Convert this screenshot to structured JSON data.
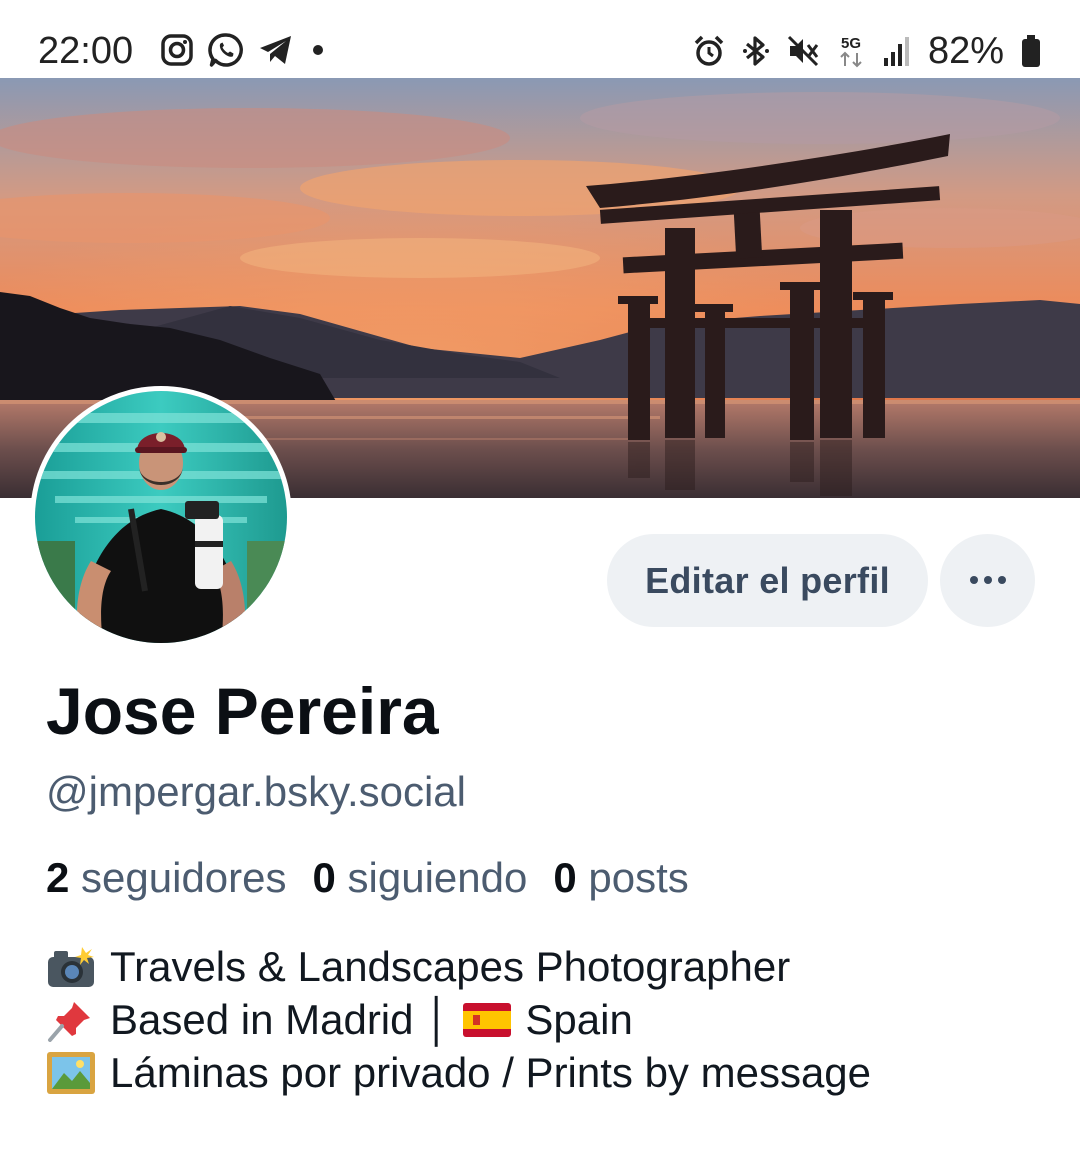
{
  "status_bar": {
    "time": "22:00",
    "battery": "82%",
    "left_icons": [
      "instagram-icon",
      "whatsapp-icon",
      "telegram-icon",
      "notification-dot-icon"
    ],
    "right_icons": [
      "alarm-icon",
      "bluetooth-icon",
      "mute-icon",
      "5g-icon",
      "signal-icon",
      "battery-icon"
    ],
    "network_label": "5G"
  },
  "banner": {
    "description_icon": "torii-gate-sunset-image"
  },
  "profile": {
    "display_name": "Jose Pereira",
    "handle": "@jmpergar.bsky.social",
    "edit_button_label": "Editar el perfil",
    "more_button_icon": "more-horizontal-icon",
    "stats": [
      {
        "count": "2",
        "label": "seguidores"
      },
      {
        "count": "0",
        "label": "siguiendo"
      },
      {
        "count": "0",
        "label": "posts"
      }
    ],
    "bio": {
      "line1": "Travels & Landscapes Photographer",
      "line2_before": "Based in Madrid │",
      "line2_after": "Spain",
      "line3": "Láminas por privado / Prints by message"
    }
  },
  "colors": {
    "accent_text": "#4c5c70",
    "button_bg": "#eef1f4",
    "button_text": "#3a4a5f"
  }
}
